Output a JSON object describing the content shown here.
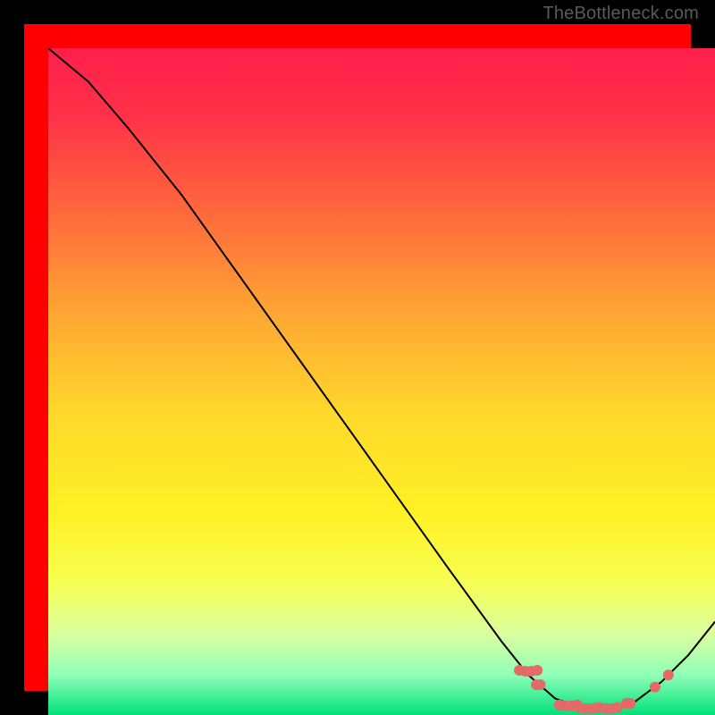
{
  "watermark": "TheBottleneck.com",
  "chart_data": {
    "type": "line",
    "title": "",
    "xlabel": "",
    "ylabel": "",
    "xlim": [
      0,
      100
    ],
    "ylim": [
      0,
      100
    ],
    "curve": {
      "name": "bottleneck-curve",
      "points": [
        {
          "x": 0,
          "y": 100
        },
        {
          "x": 6,
          "y": 95
        },
        {
          "x": 12,
          "y": 88
        },
        {
          "x": 20,
          "y": 78
        },
        {
          "x": 30,
          "y": 64
        },
        {
          "x": 40,
          "y": 50
        },
        {
          "x": 50,
          "y": 36
        },
        {
          "x": 60,
          "y": 22
        },
        {
          "x": 68,
          "y": 11
        },
        {
          "x": 72,
          "y": 6
        },
        {
          "x": 76,
          "y": 2.5
        },
        {
          "x": 80,
          "y": 1
        },
        {
          "x": 84,
          "y": 1
        },
        {
          "x": 88,
          "y": 2
        },
        {
          "x": 92,
          "y": 5
        },
        {
          "x": 96,
          "y": 9
        },
        {
          "x": 100,
          "y": 14
        }
      ]
    },
    "marker_clusters": [
      {
        "x": 72,
        "y": 6.5,
        "count": 4,
        "spread": 0.9
      },
      {
        "x": 73.5,
        "y": 4.5,
        "count": 2,
        "spread": 0.6
      },
      {
        "x": 78,
        "y": 1.3,
        "count": 4,
        "spread": 0.9
      },
      {
        "x": 81,
        "y": 0.9,
        "count": 4,
        "spread": 0.9
      },
      {
        "x": 84,
        "y": 0.9,
        "count": 4,
        "spread": 0.9
      },
      {
        "x": 87,
        "y": 1.7,
        "count": 2,
        "spread": 0.6
      },
      {
        "x": 91,
        "y": 4.2,
        "count": 1,
        "spread": 0
      },
      {
        "x": 93,
        "y": 6.0,
        "count": 1,
        "spread": 0
      }
    ],
    "gradient_stops": [
      {
        "pos": 0.0,
        "color": "#ff1f4a"
      },
      {
        "pos": 0.1,
        "color": "#ff3148"
      },
      {
        "pos": 0.25,
        "color": "#ff6a3c"
      },
      {
        "pos": 0.4,
        "color": "#ffa733"
      },
      {
        "pos": 0.55,
        "color": "#ffd92c"
      },
      {
        "pos": 0.7,
        "color": "#fff125"
      },
      {
        "pos": 0.8,
        "color": "#f6ff52"
      },
      {
        "pos": 0.88,
        "color": "#d9ffa0"
      },
      {
        "pos": 0.94,
        "color": "#8fffb8"
      },
      {
        "pos": 1.0,
        "color": "#00e07a"
      }
    ],
    "colors": {
      "frame_bg": "#000000",
      "curve": "#000000",
      "markers": "#e36a67"
    }
  }
}
